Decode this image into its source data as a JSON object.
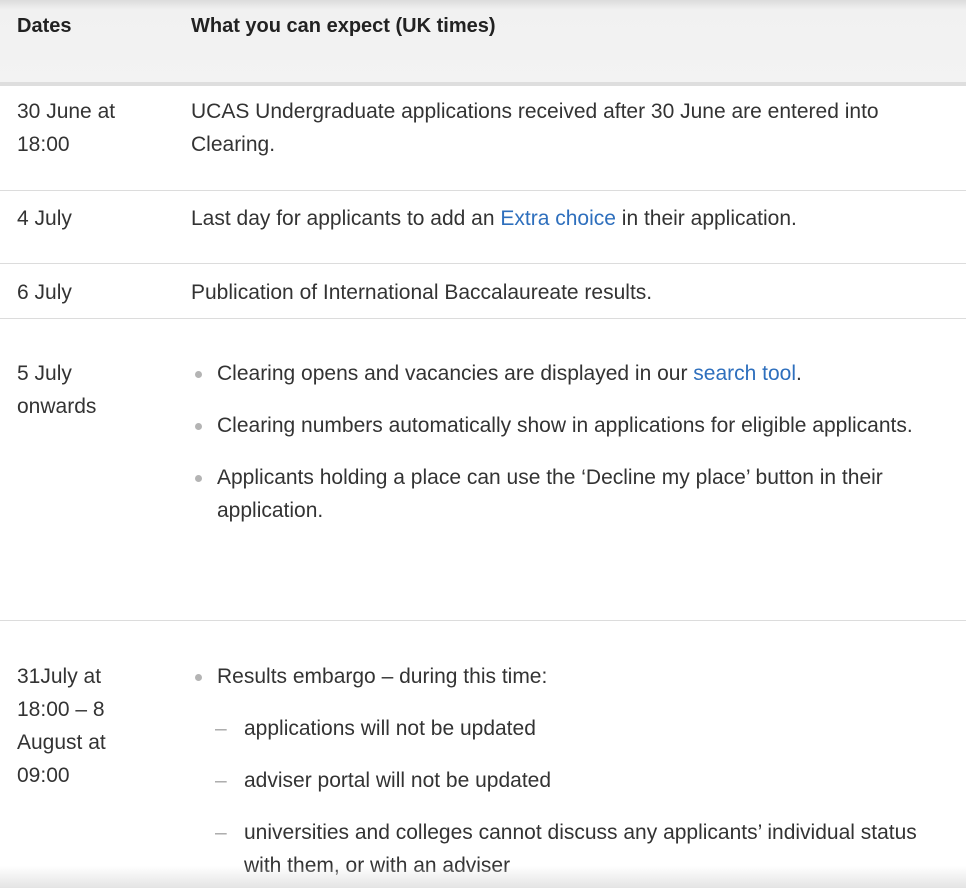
{
  "header": {
    "dates": "Dates",
    "expect": "What you can expect (UK times)"
  },
  "rows": [
    {
      "date_lines": [
        "30 June at",
        "18:00"
      ],
      "text": "UCAS Undergraduate applications received after 30 June are entered into Clearing."
    },
    {
      "date_lines": [
        "4 July"
      ],
      "text_before": "Last day for applicants to add an ",
      "link": "Extra choice",
      "text_after": " in their application."
    },
    {
      "date_lines": [
        "6 July"
      ],
      "text": "Publication of International Baccalaureate results."
    },
    {
      "date_lines": [
        "5 July",
        "onwards"
      ],
      "bullets": [
        {
          "text_before": "Clearing opens and vacancies are displayed in our ",
          "link": "search tool",
          "text_after": "."
        },
        {
          "text": "Clearing numbers automatically show in applications for eligible applicants."
        },
        {
          "text": "Applicants holding a place can use the ‘Decline my place’ button in their application."
        }
      ]
    },
    {
      "date_lines": [
        "31July at",
        "18:00 – 8",
        "August at",
        "09:00"
      ],
      "bullet": "Results embargo – during this time:",
      "sub_items": [
        "applications will not be updated",
        "adviser portal will not be updated",
        "universities and colleges cannot discuss any applicants’ individual status with them, or with an adviser"
      ]
    }
  ],
  "colors": {
    "link": "#2e6fbd",
    "text": "#333333",
    "header_bg": "#f3f3f3",
    "border": "#dcdcdc"
  }
}
